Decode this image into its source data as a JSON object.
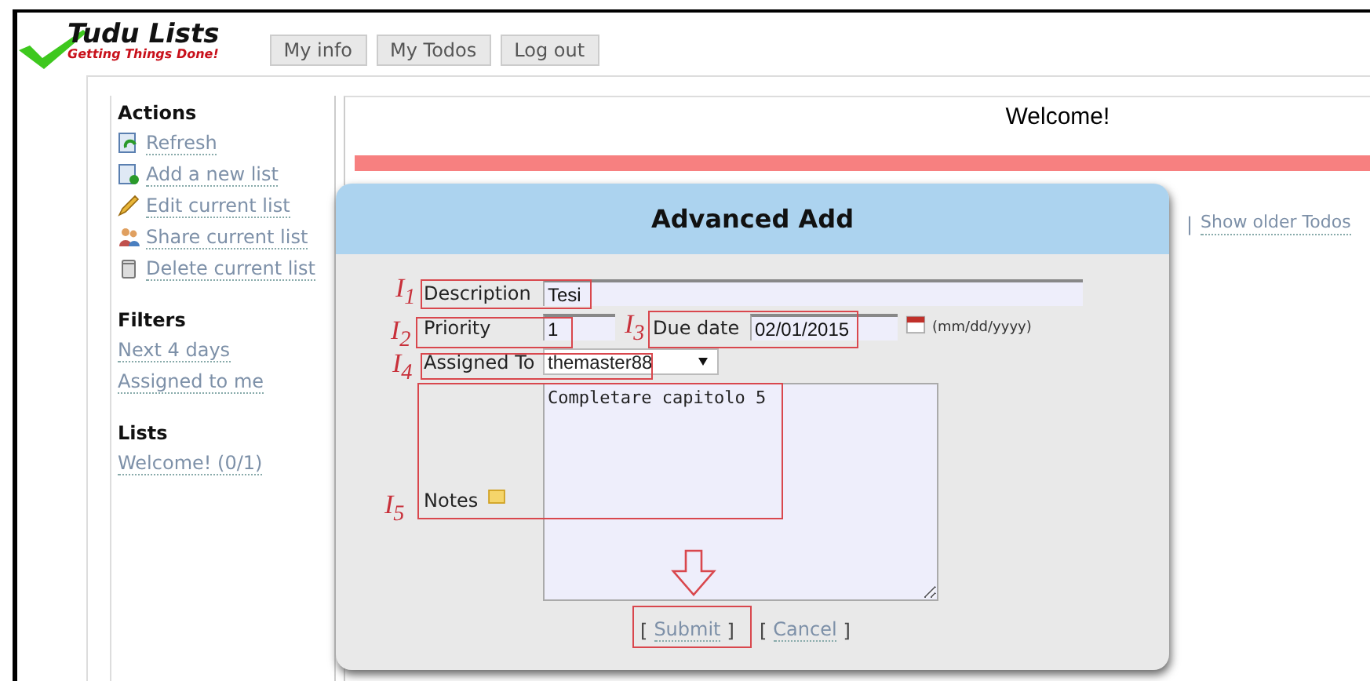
{
  "logo": {
    "title": "Tudu Lists",
    "tagline": "Getting Things Done!"
  },
  "nav": [
    "My info",
    "My Todos",
    "Log out"
  ],
  "sidebar": [
    {
      "title": "Actions",
      "items": [
        {
          "label": "Refresh"
        },
        {
          "label": "Add a new list"
        },
        {
          "label": "Edit current list"
        },
        {
          "label": "Share current list"
        },
        {
          "label": "Delete current list"
        }
      ]
    },
    {
      "title": "Filters",
      "items": [
        {
          "label": "Next 4 days"
        },
        {
          "label": "Assigned to me"
        }
      ]
    },
    {
      "title": "Lists",
      "items": [
        {
          "label": "Welcome! (0/1)"
        }
      ]
    }
  ],
  "main": {
    "title": "Welcome!",
    "separator": "|",
    "link": "Show older Todos"
  },
  "dialog": {
    "title": "Advanced Add",
    "description": {
      "label": "Description",
      "value": "Tesi"
    },
    "priority": {
      "label": "Priority",
      "value": "1"
    },
    "due_date": {
      "label": "Due date",
      "value": "02/01/2015",
      "hint": "(mm/dd/yyyy)"
    },
    "assigned_to": {
      "label": "Assigned To",
      "value": "themaster88"
    },
    "notes": {
      "label": "Notes",
      "value": "Completare capitolo 5"
    },
    "actions": [
      {
        "open": "[",
        "label": "Submit",
        "close": "]"
      },
      {
        "open": "[",
        "label": "Cancel",
        "close": "]"
      }
    ]
  },
  "annotations": [
    "I$_{1}$",
    "I$_{2}$",
    "I$_{3}$",
    "I$_{4}$",
    "I$_{5}$"
  ]
}
